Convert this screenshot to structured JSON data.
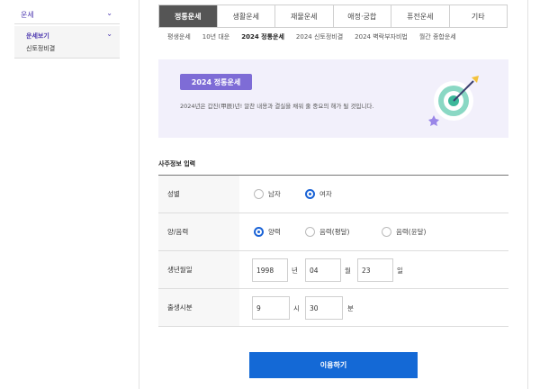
{
  "sidebar": {
    "header_label": "운세",
    "sub_label": "운세보기",
    "sub_item": "신토정비결"
  },
  "tabs": [
    {
      "label": "정통운세",
      "active": true
    },
    {
      "label": "생활운세",
      "active": false
    },
    {
      "label": "재물운세",
      "active": false
    },
    {
      "label": "애정·궁합",
      "active": false
    },
    {
      "label": "퓨전운세",
      "active": false
    },
    {
      "label": "기타",
      "active": false
    }
  ],
  "subtabs": [
    {
      "label": "평생운세",
      "active": false
    },
    {
      "label": "10년 대운",
      "active": false
    },
    {
      "label": "2024 정통운세",
      "active": true
    },
    {
      "label": "2024 신토정비결",
      "active": false
    },
    {
      "label": "2024 벽락부자비법",
      "active": false
    },
    {
      "label": "월간 종합운세",
      "active": false
    }
  ],
  "banner": {
    "badge": "2024 정통운세",
    "description": "2024년은 갑진(甲辰)년! 알찬 내용과 결실을 채워 줄 중요의 해가 될 것입니다."
  },
  "section_title": "사주정보 입력",
  "form": {
    "gender": {
      "label": "성별",
      "options": [
        "남자",
        "여자"
      ],
      "selected": "여자"
    },
    "calendar": {
      "label": "양/음력",
      "options": [
        "양력",
        "음력(평달)",
        "음력(윤달)"
      ],
      "selected": "양력"
    },
    "birthdate": {
      "label": "생년월일",
      "year": "1998",
      "year_unit": "년",
      "month": "04",
      "month_unit": "월",
      "day": "23",
      "day_unit": "일"
    },
    "birthtime": {
      "label": "출생시분",
      "hour": "9",
      "hour_unit": "시",
      "minute": "30",
      "minute_unit": "분"
    }
  },
  "submit_label": "이용하기",
  "colors": {
    "accent": "#1469d6",
    "brand_purple": "#7e6cd6",
    "active_tab": "#555555"
  }
}
